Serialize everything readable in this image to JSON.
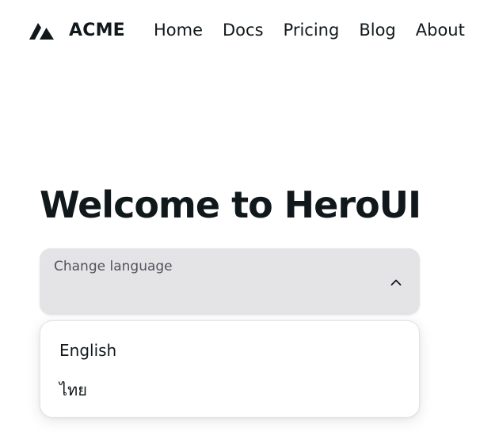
{
  "brand": {
    "logo_icon": "acme-logo-icon",
    "name": "ACME"
  },
  "nav": {
    "links": [
      {
        "label": "Home"
      },
      {
        "label": "Docs"
      },
      {
        "label": "Pricing"
      },
      {
        "label": "Blog"
      },
      {
        "label": "About"
      }
    ]
  },
  "hero": {
    "title": "Welcome to HeroUI"
  },
  "language_select": {
    "label": "Change language",
    "selected_value": "",
    "expanded": true,
    "chevron_icon": "chevron-up-icon",
    "options": [
      {
        "label": "English"
      },
      {
        "label": "ไทย"
      }
    ]
  },
  "colors": {
    "text": "#11181c",
    "trigger_bg": "#e4e4e7",
    "label_muted": "#52525b",
    "popover_bg": "#ffffff",
    "popover_border": "#e4e4e7"
  }
}
